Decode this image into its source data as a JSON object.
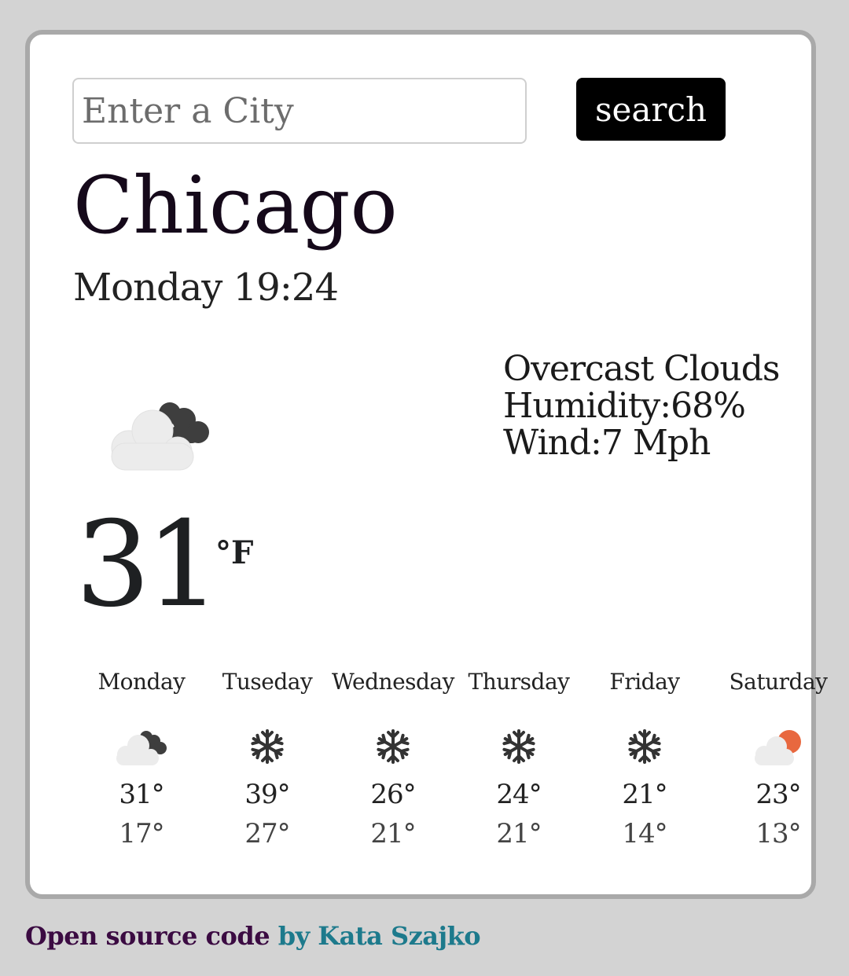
{
  "search": {
    "placeholder": "Enter a City",
    "value": "",
    "button_label": "search"
  },
  "current": {
    "city": "Chicago",
    "datetime": "Monday 19:24",
    "description": "Overcast Clouds",
    "humidity": "Humidity:68%",
    "wind": "Wind:7 Mph",
    "temperature": "31",
    "unit": "°F",
    "icon": "overcast-clouds-icon"
  },
  "forecast": [
    {
      "day": "Monday",
      "max": "31°",
      "min": "17°",
      "icon": "overcast-clouds-icon"
    },
    {
      "day": "Tuseday",
      "max": "39°",
      "min": "27°",
      "icon": "snowflake-icon"
    },
    {
      "day": "Wednesday",
      "max": "26°",
      "min": "21°",
      "icon": "snowflake-icon"
    },
    {
      "day": "Thursday",
      "max": "24°",
      "min": "21°",
      "icon": "snowflake-icon"
    },
    {
      "day": "Friday",
      "max": "21°",
      "min": "14°",
      "icon": "snowflake-icon"
    },
    {
      "day": "Saturday",
      "max": "23°",
      "min": "13°",
      "icon": "few-clouds-icon"
    }
  ],
  "footer": {
    "link_text": "Open source code",
    "author_text": "by Kata Szajko"
  },
  "colors": {
    "page_background": "#d3d3d3",
    "card_border": "#a9a9a9",
    "button": "#000000",
    "footer_link": "#3b0b42",
    "footer_author": "#1d7a8c",
    "sun": "#e8683f"
  }
}
